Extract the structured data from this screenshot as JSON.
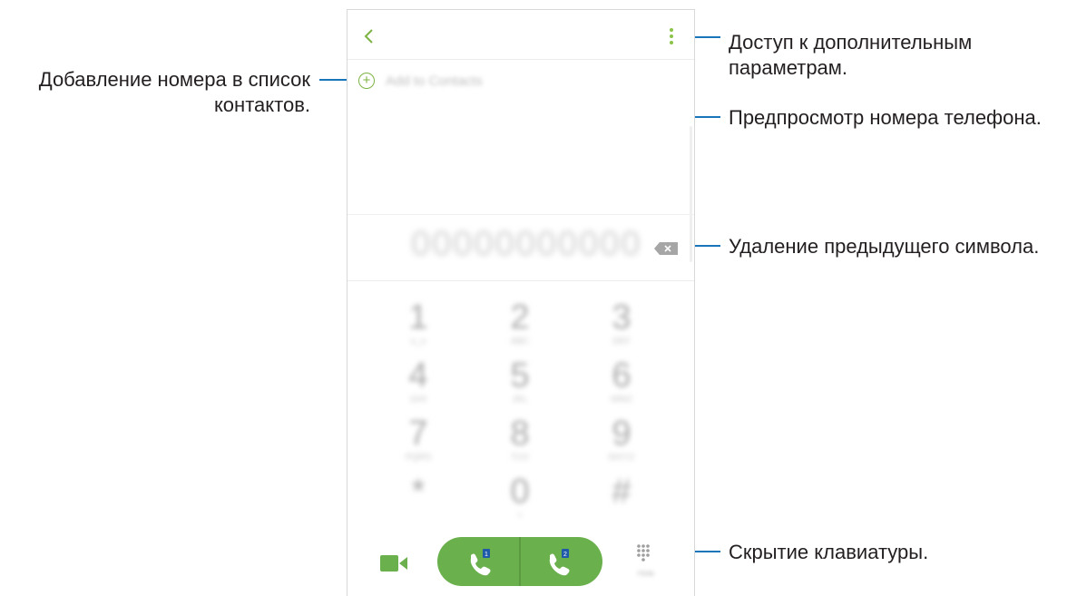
{
  "callouts": {
    "add_contact": "Добавление номера в список контактов.",
    "more_options": "Доступ к дополнительным параметрам.",
    "number_preview": "Предпросмотр номера телефона.",
    "delete_char": "Удаление предыдущего символа.",
    "hide_keypad": "Скрытие клавиатуры."
  },
  "screen": {
    "add_contact_label": "Add to Contacts",
    "number_display": "00000000000",
    "keys": [
      {
        "digit": "1",
        "letters": "o_o"
      },
      {
        "digit": "2",
        "letters": "ABC"
      },
      {
        "digit": "3",
        "letters": "DEF"
      },
      {
        "digit": "4",
        "letters": "GHI"
      },
      {
        "digit": "5",
        "letters": "JKL"
      },
      {
        "digit": "6",
        "letters": "MNO"
      },
      {
        "digit": "7",
        "letters": "PQRS"
      },
      {
        "digit": "8",
        "letters": "TUV"
      },
      {
        "digit": "9",
        "letters": "WXYZ"
      },
      {
        "digit": "*",
        "letters": ""
      },
      {
        "digit": "0",
        "letters": "+"
      },
      {
        "digit": "#",
        "letters": ""
      }
    ],
    "call_sims": [
      "1",
      "2"
    ],
    "keypad_label": "Hide"
  },
  "colors": {
    "leader_line": "#1b75bb",
    "accent_green": "#6ab04c",
    "text": "#231f20"
  },
  "icons": [
    "back-icon",
    "more-options-icon",
    "add-icon",
    "backspace-icon",
    "video-call-icon",
    "phone-icon",
    "keypad-icon"
  ]
}
